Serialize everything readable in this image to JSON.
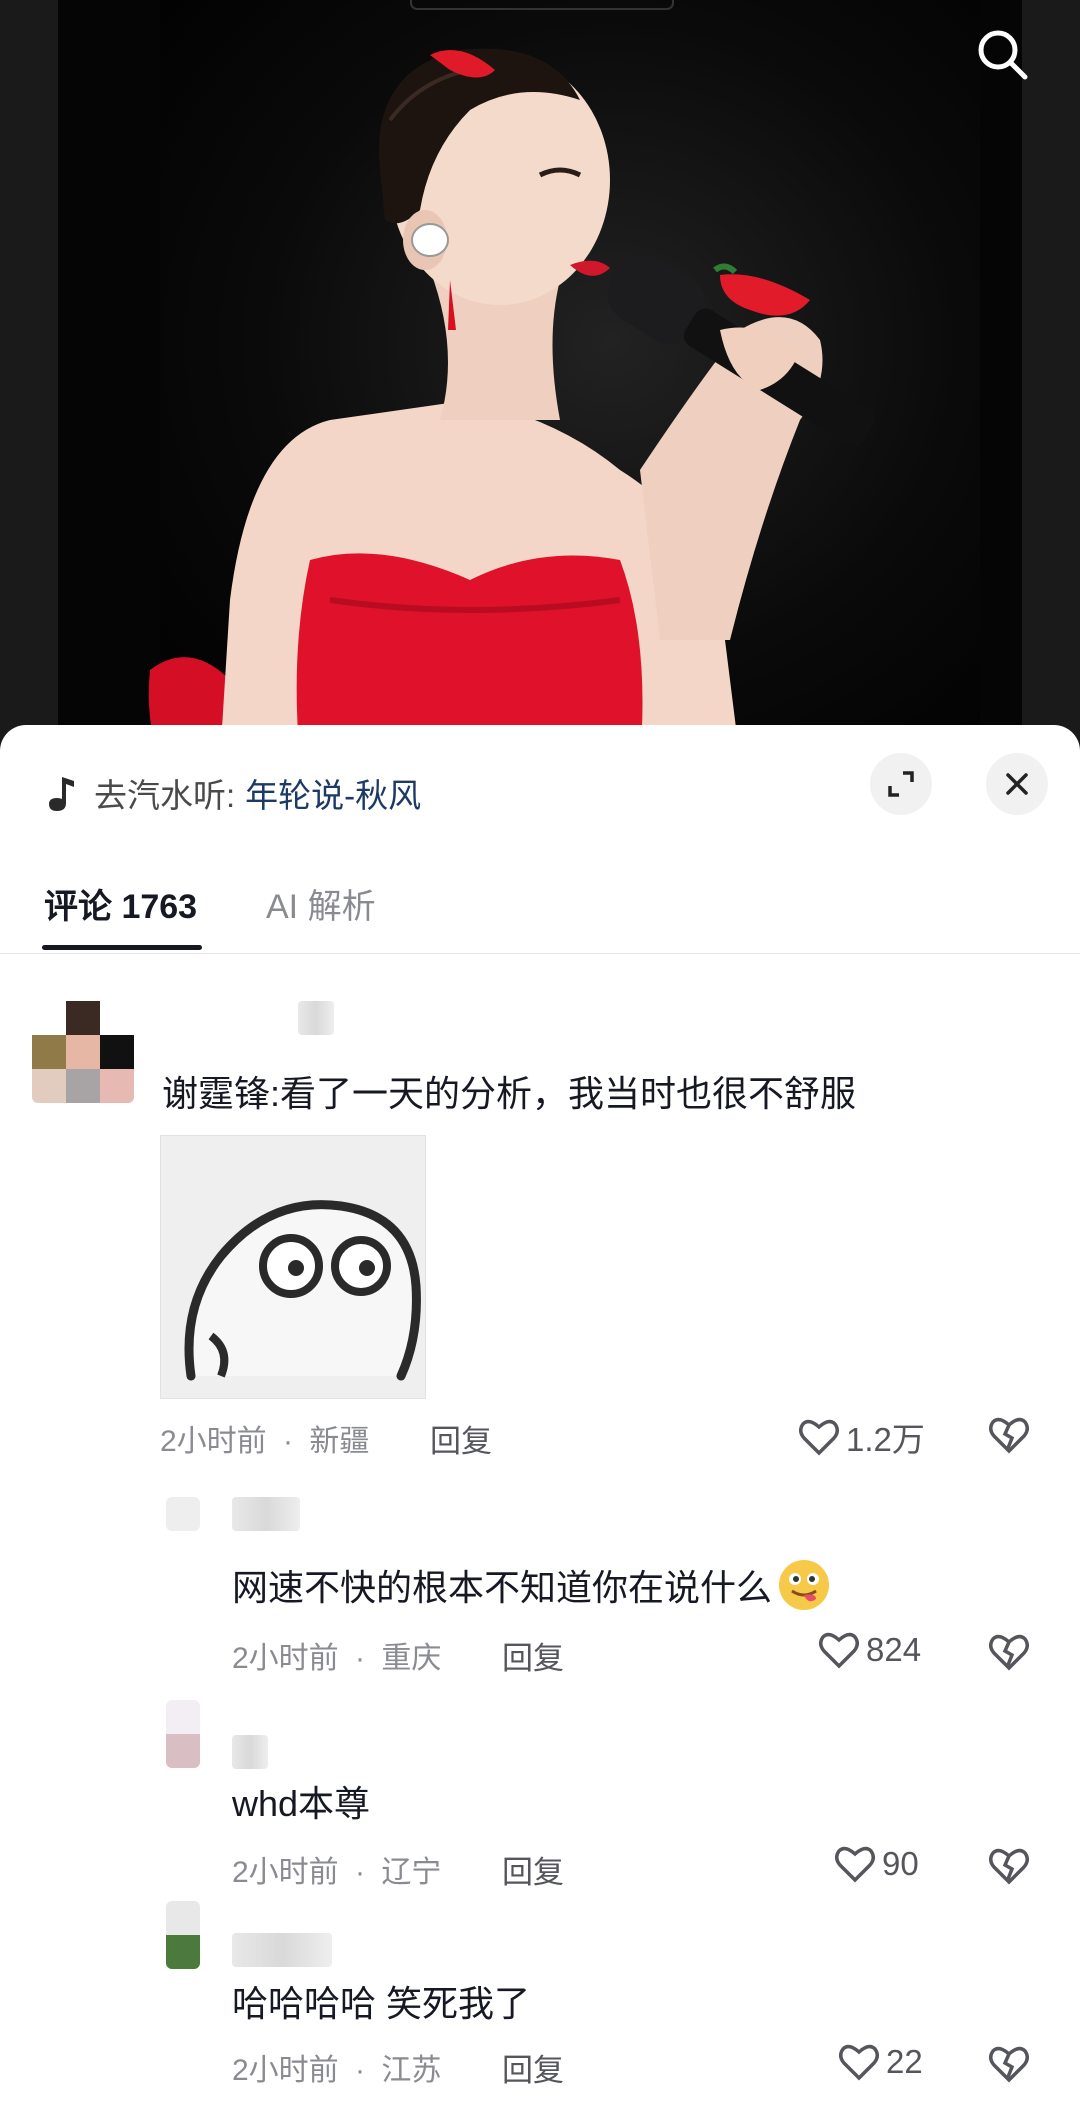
{
  "music": {
    "prefix": "去汽水听:",
    "song": "年轮说-秋风"
  },
  "tabs": [
    {
      "label": "评论 1763",
      "active": true
    },
    {
      "label": "AI 解析",
      "active": false
    }
  ],
  "comments": [
    {
      "text": "谢霆锋:看了一天的分析，我当时也很不舒服",
      "time": "2小时前",
      "location": "新疆",
      "reply_label": "回复",
      "likes": "1.2万",
      "has_sticker": true
    },
    {
      "text": "网速不快的根本不知道你在说什么",
      "time": "2小时前",
      "location": "重庆",
      "reply_label": "回复",
      "likes": "824"
    },
    {
      "text": "whd本尊",
      "time": "2小时前",
      "location": "辽宁",
      "reply_label": "回复",
      "likes": "90"
    },
    {
      "text": "哈哈哈哈 笑死我了",
      "time": "2小时前",
      "location": "江苏",
      "reply_label": "回复",
      "likes": "22"
    }
  ],
  "separator": "·",
  "colors": {
    "sheet_bg": "#ffffff",
    "song_link": "#1c3a66",
    "dress_red": "#e0112a",
    "meta_gray": "#8a8b91"
  }
}
